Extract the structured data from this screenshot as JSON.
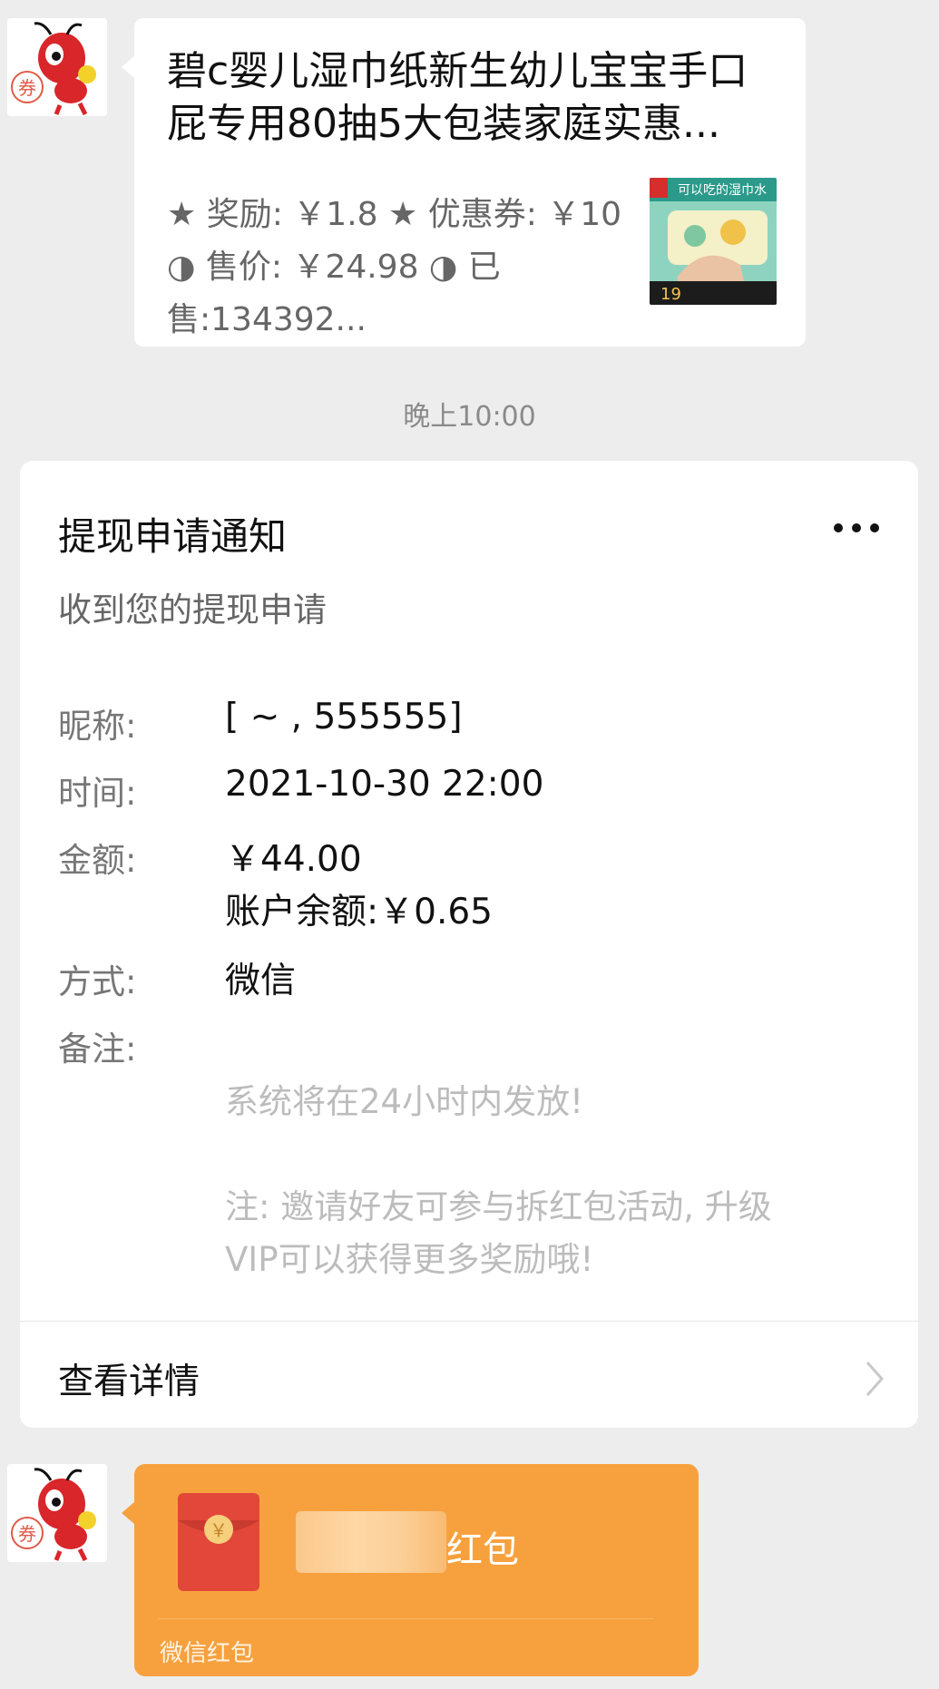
{
  "product": {
    "title_line1": "碧c婴儿湿巾纸新生幼儿宝宝手口",
    "title_line2": "屁专用80抽5大包装家庭实惠...",
    "info_line1": "★ 奖励: ￥1.8 ★ 优惠券: ￥10",
    "info_line2": "◑ 售价: ￥24.98 ◑ 已",
    "info_line3": "售:134392...",
    "thumb_text_top": "可以吃的湿巾水",
    "thumb_price": "19"
  },
  "avatar": {
    "badge": "券"
  },
  "timestamp": "晚上10:00",
  "notice": {
    "title": "提现申请通知",
    "subtitle": "收到您的提现申请",
    "nickname_label": "昵称:",
    "nickname_value": "[ ~ , 555555]",
    "time_label": "时间:",
    "time_value": "2021-10-30 22:00",
    "amount_label": "金额:",
    "amount_value": "￥44.00",
    "balance_value": "账户余额:￥0.65",
    "method_label": "方式:",
    "method_value": "微信",
    "remark_label": "备注:",
    "remark_line1": "系统将在24小时内发放!",
    "remark_line2": "注: 邀请好友可参与拆红包活动, 升级",
    "remark_line3": "VIP可以获得更多奖励哦!",
    "detail_link": "查看详情"
  },
  "red_packet": {
    "title": "红包",
    "footer": "微信红包",
    "coin": "￥"
  },
  "colors": {
    "background": "#ededed",
    "red_packet": "#f7a13e",
    "envelope": "#e2473a"
  }
}
